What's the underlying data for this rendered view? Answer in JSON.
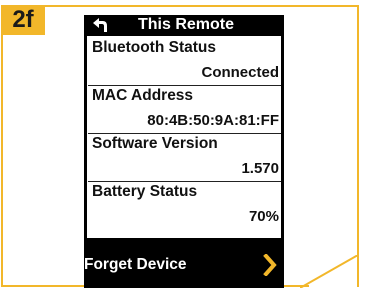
{
  "step": {
    "tag": "2f"
  },
  "header": {
    "title": "This Remote",
    "back_icon": "back-arrow-icon"
  },
  "rows": [
    {
      "label": "Bluetooth Status",
      "value": "Connected"
    },
    {
      "label": "MAC Address",
      "value": "80:4B:50:9A:81:FF"
    },
    {
      "label": "Software Version",
      "value": "1.570"
    },
    {
      "label": "Battery Status",
      "value": "70%"
    }
  ],
  "forget": {
    "label": "Forget Device",
    "icon": "chevron-right-icon"
  },
  "colors": {
    "accent": "#f2b72a",
    "chevron": "#f2b72a",
    "device": "#000000"
  }
}
